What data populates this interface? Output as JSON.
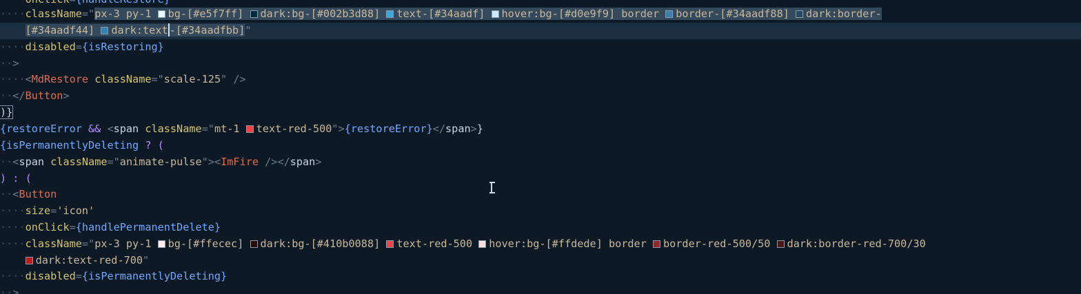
{
  "editor": {
    "cursor_icon": "i-beam-icon",
    "swatches": {
      "bg-e5f7ff": "#e5f7ff",
      "dark-bg-002b3d": "#002b3d",
      "text-34aadf": "#34aadf",
      "hover-bg-d0e9f9": "#d0e9f9",
      "border-34aadf88": "#3d7fa8",
      "dark-border-34aadf44": "#254a63",
      "dark-text-34aadfbb": "#2e86b6",
      "text-red-500": "#ef4444",
      "bg-ffecec": "#ffecec",
      "dark-bg-410b00": "#2a0a05",
      "hover-bg-ffdede": "#ffdede",
      "border-red-500-50": "#8a2a2a",
      "dark-border-red-700-30": "#4a1a1a",
      "dark-text-red-700": "#b91c1c"
    },
    "tokens": {
      "onClick_attr": "onClick",
      "handleRestore": "{handleRestore}",
      "className_attr": "className",
      "eq": "=",
      "q": "\"",
      "px3py1": "px-3 py-1 ",
      "bg_e5f7ff": "bg-[#e5f7ff] ",
      "darkbg_002b3d88": "dark:bg-[#002b3d88] ",
      "text_34aadf": "text-[#34aadf] ",
      "hoverbg_d0e9f9": "hover:bg-[#d0e9f9] ",
      "border_word": "border ",
      "border_34aadf88": "border-[#34aadf88] ",
      "darkborder_prefix": "dark:border-",
      "darkborder_suffix": "[#34aadf44] ",
      "darktext_part1": "dark:text",
      "darktext_part2": "-[#34aadfbb]",
      "disabled_attr": "disabled",
      "isRestoring": "{isRestoring}",
      "gt": ">",
      "lt": "<",
      "MdRestore": "MdRestore",
      "scale125": "scale-125",
      "selfclose": " />",
      "close_button_open": "</",
      "Button": "Button",
      "close_brace_paren": ")}",
      "restoreError_open": "{restoreError",
      "andand": " && ",
      "span": "span",
      "mt1": "mt-1 ",
      "text_red_500": "text-red-500",
      "restoreError_inner": "{restoreError}",
      "close_brace": "}",
      "isPermDel_open": "{isPermanentlyDeleting",
      "ternary_open": " ? (",
      "animate_pulse": "animate-pulse",
      "ImFire": "ImFire",
      "selfclose_nospace": " />",
      "ternary_else": ") : (",
      "size_attr": "size",
      "icon_str": "'icon'",
      "handlePermanentDelete": "{handlePermanentDelete}",
      "bg_ffecec": "bg-[#ffecec] ",
      "darkbg_410b0088": "dark:bg-[#410b0088] ",
      "text_red_500_sp": "text-red-500 ",
      "hoverbg_ffdede": "hover:bg-[#ffdede] ",
      "border_red_500_50": "border-red-500/50 ",
      "darkborder_red_700_30": "dark:border-red-700/30",
      "darktext_red_700": "dark:text-red-700",
      "isPermanentlyDeleting": "{isPermanentlyDeleting}"
    }
  }
}
